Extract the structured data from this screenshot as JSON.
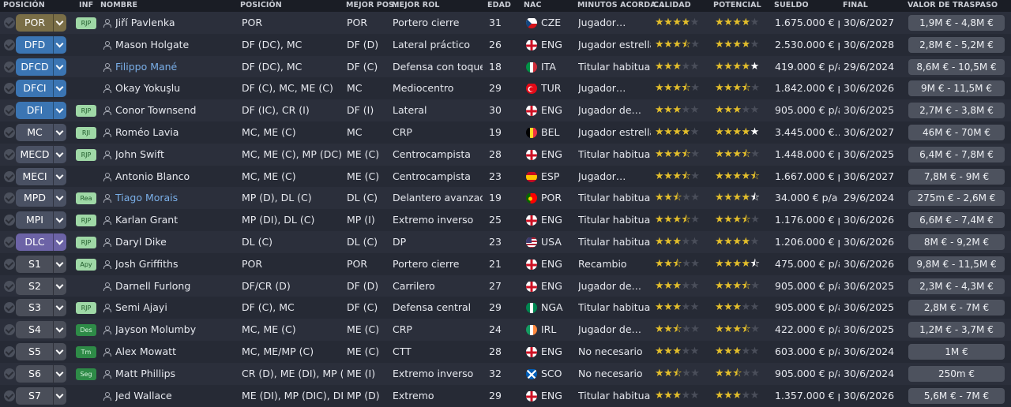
{
  "headers": {
    "posicion": "POSICIÓN",
    "inf": "INF",
    "nombre": "NOMBRE",
    "posicion2": "POSICIÓN",
    "mejor_pos": "MEJOR POS.",
    "mejor_rol": "MEJOR ROL",
    "edad": "EDAD",
    "nac": "NAC",
    "minutos": "MINUTOS ACORDA…",
    "calidad": "CALIDAD",
    "potencial": "POTENCIAL",
    "sueldo": "SUELDO",
    "final": "FINAL",
    "valor": "VALOR DE TRASPASO"
  },
  "colors": {
    "por": "#7a6e47",
    "def": "#3b75b3",
    "mid": "#4a5163",
    "att": "#6c63a6",
    "sub": "#4a4e59",
    "star": "#e3be2b",
    "star_empty": "#4a4e5a",
    "inf_light": "#9fd8a6",
    "inf_dark": "#2e8b47",
    "link": "#7aafe8"
  },
  "players": [
    {
      "slot": "POR",
      "slot_color": "por",
      "inf": "RJP",
      "inf_style": "light",
      "name": "Jiří Pavlenka",
      "link": false,
      "position": "POR",
      "best_pos": "POR",
      "best_role": "Portero cierre",
      "age": "31",
      "nat_icon": "flag-cze",
      "nat": "CZE",
      "minutes": "Jugador…",
      "quality": 4,
      "potential": 4,
      "pot_style": "normal",
      "wage": "1.675.000 € p…",
      "end": "30/6/2027",
      "value": "1,9M € - 4,8M €"
    },
    {
      "slot": "DFD",
      "slot_color": "def",
      "inf": "",
      "inf_style": "",
      "name": "Mason Holgate",
      "link": false,
      "position": "DF (DC), MC",
      "best_pos": "DF (D)",
      "best_role": "Lateral práctico",
      "age": "26",
      "nat_icon": "flag-eng",
      "nat": "ENG",
      "minutes": "Jugador estrella",
      "quality": 3.5,
      "potential": 4,
      "pot_style": "normal",
      "wage": "2.530.000 € p…",
      "end": "30/6/2028",
      "value": "2,8M € - 5,2M €"
    },
    {
      "slot": "DFCD",
      "slot_color": "def",
      "inf": "",
      "inf_style": "",
      "name": "Filippo Mané",
      "link": true,
      "position": "DF (DC), MC",
      "best_pos": "DF (C)",
      "best_role": "Defensa con toque",
      "age": "18",
      "nat_icon": "flag-ita",
      "nat": "ITA",
      "minutes": "Titular habitual",
      "quality": 3,
      "potential": 5,
      "pot_style": "white-last",
      "wage": "419.000 € p/a",
      "end": "29/6/2024",
      "value": "8,6M € - 10,5M €"
    },
    {
      "slot": "DFCI",
      "slot_color": "def",
      "inf": "",
      "inf_style": "",
      "name": "Okay Yokuşlu",
      "link": false,
      "position": "DF (C), MC, ME (C)",
      "best_pos": "MC",
      "best_role": "Mediocentro",
      "age": "29",
      "nat_icon": "flag-tur",
      "nat": "TUR",
      "minutes": "Jugador…",
      "quality": 3.5,
      "potential": 3.5,
      "pot_style": "normal",
      "wage": "1.842.000 € p…",
      "end": "30/6/2026",
      "value": "9M € - 11,5M €"
    },
    {
      "slot": "DFI",
      "slot_color": "def",
      "inf": "RJP",
      "inf_style": "light",
      "name": "Conor Townsend",
      "link": false,
      "position": "DF (IC), CR (I)",
      "best_pos": "DF (I)",
      "best_role": "Lateral",
      "age": "30",
      "nat_icon": "flag-eng",
      "nat": "ENG",
      "minutes": "Jugador de…",
      "quality": 3,
      "potential": 3,
      "pot_style": "normal",
      "wage": "905.000 € p/a",
      "end": "30/6/2025",
      "value": "2,7M € - 3,8M €"
    },
    {
      "slot": "MC",
      "slot_color": "mid",
      "inf": "RJI",
      "inf_style": "light",
      "name": "Roméo Lavia",
      "link": false,
      "position": "MC, ME (C)",
      "best_pos": "MC",
      "best_role": "CRP",
      "age": "19",
      "nat_icon": "flag-bel",
      "nat": "BEL",
      "minutes": "Jugador estrella",
      "quality": 4,
      "potential": 5,
      "pot_style": "white-last",
      "wage": "3.445.000 €…",
      "end": "30/6/2027",
      "value": "46M € - 70M €"
    },
    {
      "slot": "MECD",
      "slot_color": "mid",
      "inf": "RJP",
      "inf_style": "light",
      "name": "John Swift",
      "link": false,
      "position": "MC, ME (C), MP (DC)",
      "best_pos": "ME (C)",
      "best_role": "Centrocampista",
      "age": "28",
      "nat_icon": "flag-eng",
      "nat": "ENG",
      "minutes": "Titular habitual",
      "quality": 3.5,
      "potential": 3.5,
      "pot_style": "normal",
      "wage": "1.448.000 € p…",
      "end": "30/6/2025",
      "value": "6,4M € - 7,8M €"
    },
    {
      "slot": "MECI",
      "slot_color": "mid",
      "inf": "",
      "inf_style": "",
      "name": "Antonio Blanco",
      "link": false,
      "position": "MC, ME (C)",
      "best_pos": "ME (C)",
      "best_role": "Centrocampista",
      "age": "23",
      "nat_icon": "flag-esp",
      "nat": "ESP",
      "minutes": "Jugador…",
      "quality": 3.5,
      "potential": 4.5,
      "pot_style": "normal",
      "wage": "1.667.000 € p…",
      "end": "30/6/2027",
      "value": "7,8M € - 9M €"
    },
    {
      "slot": "MPD",
      "slot_color": "mid",
      "inf": "Rea",
      "inf_style": "light",
      "name": "Tiago Morais",
      "link": true,
      "position": "MP (D), DL (C)",
      "best_pos": "DL (C)",
      "best_role": "Delantero avanzado",
      "age": "19",
      "nat_icon": "flag-por",
      "nat": "POR",
      "minutes": "Titular habitual",
      "quality": 2.5,
      "potential": 4.5,
      "pot_style": "white-half",
      "wage": "34.000 € p/a",
      "end": "29/6/2024",
      "value": "275m € - 2,6M €"
    },
    {
      "slot": "MPI",
      "slot_color": "mid",
      "inf": "RJP",
      "inf_style": "light",
      "name": "Karlan Grant",
      "link": false,
      "position": "MP (DI), DL (C)",
      "best_pos": "MP (I)",
      "best_role": "Extremo inverso",
      "age": "25",
      "nat_icon": "flag-eng",
      "nat": "ENG",
      "minutes": "Titular habitual",
      "quality": 3.5,
      "potential": 3.5,
      "pot_style": "normal",
      "wage": "1.176.000 € p…",
      "end": "30/6/2026",
      "value": "6,6M € - 7,4M €"
    },
    {
      "slot": "DLC",
      "slot_color": "att",
      "inf": "RJP",
      "inf_style": "light",
      "name": "Daryl Dike",
      "link": false,
      "position": "DL (C)",
      "best_pos": "DL (C)",
      "best_role": "DP",
      "age": "23",
      "nat_icon": "flag-usa",
      "nat": "USA",
      "minutes": "Titular habitual",
      "quality": 3,
      "potential": 4,
      "pot_style": "normal",
      "wage": "1.206.000 € p…",
      "end": "30/6/2026",
      "value": "8M € - 9,2M €"
    },
    {
      "slot": "S1",
      "slot_color": "sub",
      "inf": "Apy",
      "inf_style": "light",
      "name": "Josh Griffiths",
      "link": false,
      "position": "POR",
      "best_pos": "POR",
      "best_role": "Portero cierre",
      "age": "21",
      "nat_icon": "flag-eng",
      "nat": "ENG",
      "minutes": "Recambio",
      "quality": 2.5,
      "potential": 4.5,
      "pot_style": "white-half",
      "wage": "475.000 € p/a",
      "end": "30/6/2026",
      "value": "9,8M € - 11,5M €"
    },
    {
      "slot": "S2",
      "slot_color": "sub",
      "inf": "",
      "inf_style": "",
      "name": "Darnell Furlong",
      "link": false,
      "position": "DF/CR (D)",
      "best_pos": "DF (D)",
      "best_role": "Carrilero",
      "age": "27",
      "nat_icon": "flag-eng",
      "nat": "ENG",
      "minutes": "Jugador de…",
      "quality": 3,
      "potential": 3.5,
      "pot_style": "normal",
      "wage": "905.000 € p/a",
      "end": "30/6/2025",
      "value": "2,3M € - 4,3M €"
    },
    {
      "slot": "S3",
      "slot_color": "sub",
      "inf": "RJP",
      "inf_style": "light",
      "name": "Semi Ajayi",
      "link": false,
      "position": "DF (C), MC",
      "best_pos": "DF (C)",
      "best_role": "Defensa central",
      "age": "29",
      "nat_icon": "flag-nga",
      "nat": "NGA",
      "minutes": "Titular habitual",
      "quality": 3,
      "potential": 3,
      "pot_style": "normal",
      "wage": "905.000 € p/a",
      "end": "30/6/2025",
      "value": "2,8M € - 7M €"
    },
    {
      "slot": "S4",
      "slot_color": "sub",
      "inf": "Des",
      "inf_style": "dark",
      "name": "Jayson Molumby",
      "link": false,
      "position": "MC, ME (C)",
      "best_pos": "ME (C)",
      "best_role": "CRP",
      "age": "24",
      "nat_icon": "flag-irl",
      "nat": "IRL",
      "minutes": "Jugador de…",
      "quality": 2.5,
      "potential": 3.5,
      "pot_style": "normal",
      "wage": "422.000 € p/a",
      "end": "30/6/2025",
      "value": "1,2M € - 3,7M €"
    },
    {
      "slot": "S5",
      "slot_color": "sub",
      "inf": "Tm",
      "inf_style": "dark",
      "name": "Alex Mowatt",
      "link": false,
      "position": "MC, ME/MP (C)",
      "best_pos": "ME (C)",
      "best_role": "CTT",
      "age": "28",
      "nat_icon": "flag-eng",
      "nat": "ENG",
      "minutes": "No necesario",
      "quality": 3,
      "potential": 3,
      "pot_style": "normal",
      "wage": "603.000 € p/a",
      "end": "30/6/2024",
      "value": "1M €"
    },
    {
      "slot": "S6",
      "slot_color": "sub",
      "inf": "Seg",
      "inf_style": "dark",
      "name": "Matt Phillips",
      "link": false,
      "position": "CR (D), ME (DI), MP (D)",
      "best_pos": "ME (I)",
      "best_role": "Extremo inverso",
      "age": "32",
      "nat_icon": "flag-sco",
      "nat": "SCO",
      "minutes": "No necesario",
      "quality": 2.5,
      "potential": 2.5,
      "pot_style": "normal",
      "wage": "905.000 € p/a",
      "end": "30/6/2024",
      "value": "250m €"
    },
    {
      "slot": "S7",
      "slot_color": "sub",
      "inf": "",
      "inf_style": "",
      "name": "Jed Wallace",
      "link": false,
      "position": "ME (DI), MP (DIC), DL (…",
      "best_pos": "MP (D)",
      "best_role": "Extremo",
      "age": "29",
      "nat_icon": "flag-eng",
      "nat": "ENG",
      "minutes": "Titular habitual",
      "quality": 3,
      "potential": 3,
      "pot_style": "normal",
      "wage": "1.357.000 € p…",
      "end": "30/6/2026",
      "value": "5,6M € - 7M €"
    }
  ]
}
